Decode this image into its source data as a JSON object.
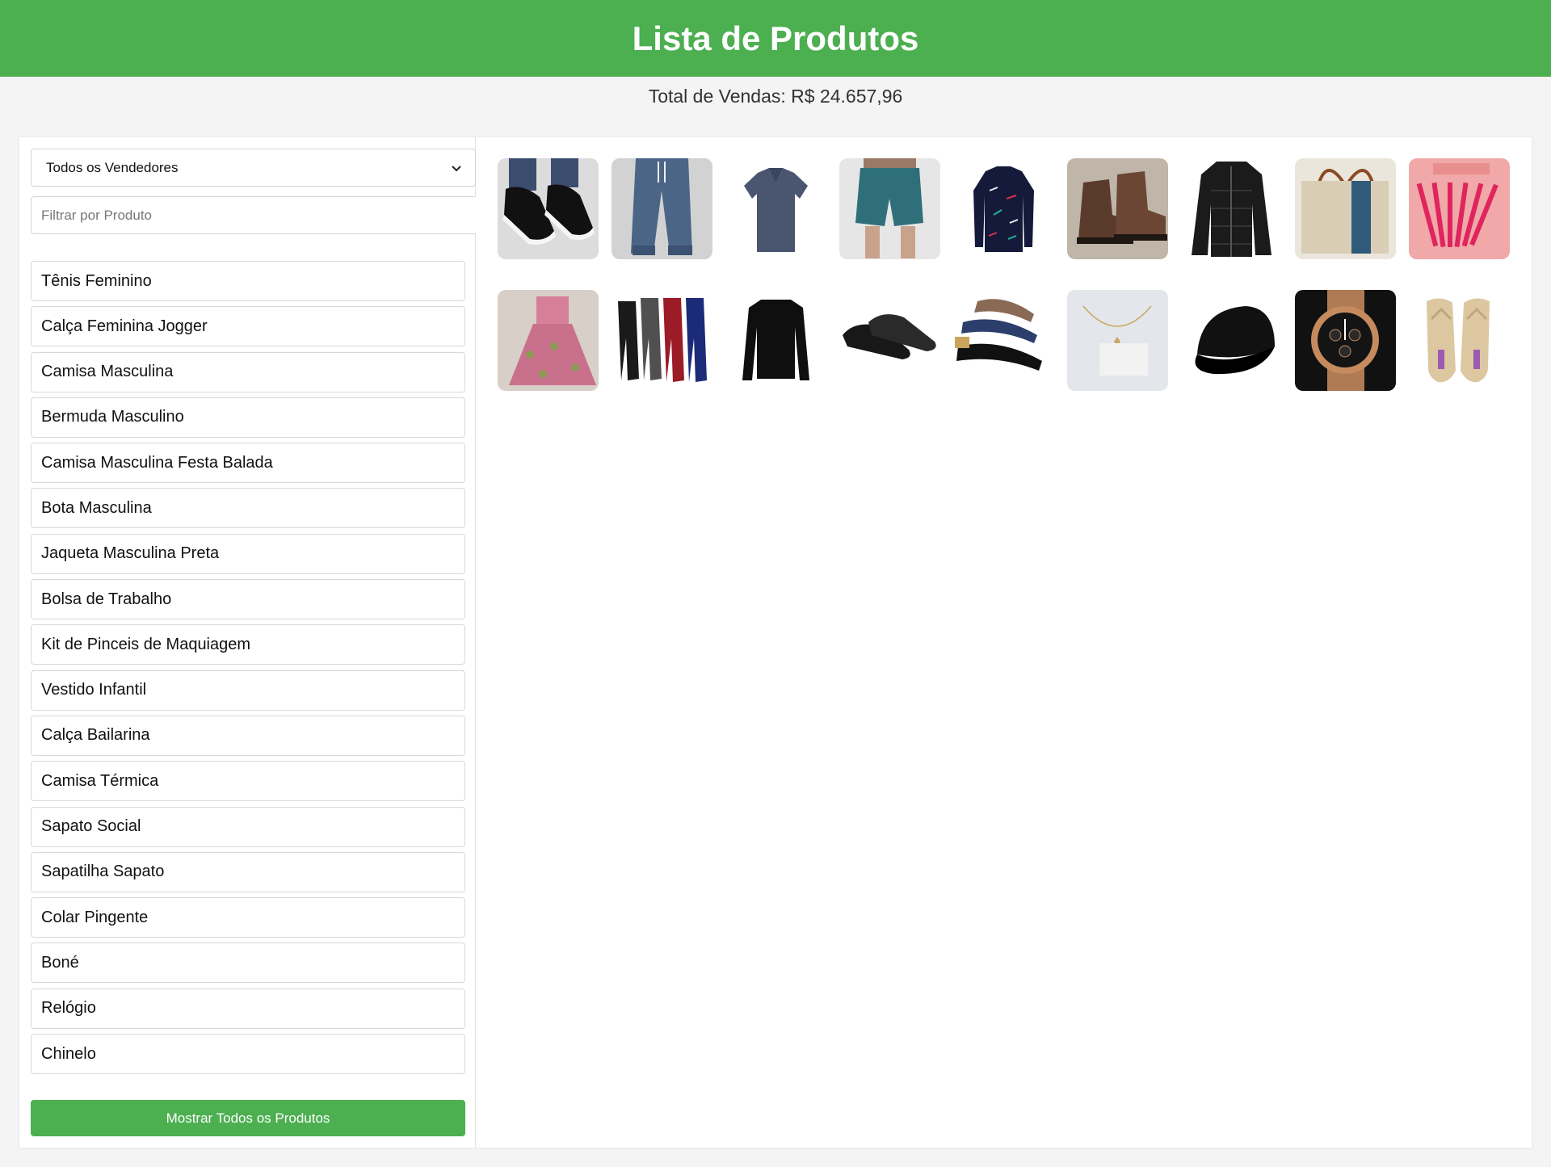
{
  "header": {
    "title": "Lista de Produtos"
  },
  "summary": {
    "total_sales": "Total de Vendas: R$ 24.657,96"
  },
  "sidebar": {
    "vendor_select": {
      "selected": "Todos os Vendedores"
    },
    "filter": {
      "placeholder": "Filtrar por Produto",
      "value": ""
    },
    "products": [
      "Tênis Feminino",
      "Calça Feminina Jogger",
      "Camisa Masculina",
      "Bermuda Masculino",
      "Camisa Masculina Festa Balada",
      "Bota Masculina",
      "Jaqueta Masculina Preta",
      "Bolsa de Trabalho",
      "Kit de Pinceis de Maquiagem",
      "Vestido Infantil",
      "Calça Bailarina",
      "Camisa Térmica",
      "Sapato Social",
      "Sapatilha Sapato",
      "Colar Pingente",
      "Boné",
      "Relógio",
      "Chinelo"
    ],
    "show_all_label": "Mostrar Todos os Produtos"
  },
  "gallery": {
    "items": [
      {
        "name": "tenis-feminino-image",
        "bg": "#dcdcdc"
      },
      {
        "name": "calca-feminina-jogger-image",
        "bg": "#d2d2d2"
      },
      {
        "name": "camisa-masculina-image",
        "bg": "#ffffff"
      },
      {
        "name": "bermuda-masculino-image",
        "bg": "#e6e6e6"
      },
      {
        "name": "camisa-festa-balada-image",
        "bg": "#ffffff"
      },
      {
        "name": "bota-masculina-image",
        "bg": "#bfb5a8"
      },
      {
        "name": "jaqueta-masculina-preta-image",
        "bg": "#ffffff"
      },
      {
        "name": "bolsa-de-trabalho-image",
        "bg": "#ebe6dc"
      },
      {
        "name": "kit-pinceis-maquiagem-image",
        "bg": "#f0a8a8"
      },
      {
        "name": "vestido-infantil-image",
        "bg": "#d7cfc8"
      },
      {
        "name": "calca-bailarina-image",
        "bg": "#ffffff"
      },
      {
        "name": "camisa-termica-image",
        "bg": "#ffffff"
      },
      {
        "name": "sapato-social-image",
        "bg": "#ffffff"
      },
      {
        "name": "sapatilha-sapato-image",
        "bg": "#ffffff"
      },
      {
        "name": "colar-pingente-image",
        "bg": "#e3e6ea"
      },
      {
        "name": "bone-image",
        "bg": "#ffffff"
      },
      {
        "name": "relogio-image",
        "bg": "#111111"
      },
      {
        "name": "chinelo-image",
        "bg": "#ffffff"
      }
    ]
  },
  "colors": {
    "accent": "#4caf50"
  }
}
